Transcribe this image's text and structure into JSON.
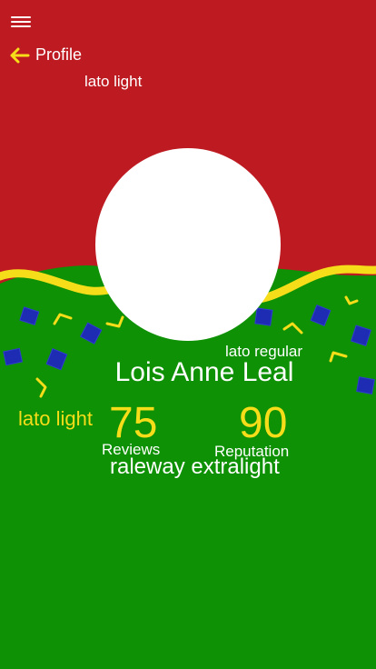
{
  "header": {
    "back_label": "Profile",
    "font_note": "lato light"
  },
  "profile": {
    "name": "Lois Anne Leal",
    "name_font_note": "lato regular",
    "stats_font_note": "lato light",
    "bottom_font_note": "raleway extralight"
  },
  "stats": {
    "reviews_value": "75",
    "reviews_label": "Reviews",
    "reputation_value": "90",
    "reputation_label": "Reputation"
  },
  "colors": {
    "red": "#bd1b21",
    "green": "#0e9104",
    "yellow": "#f6dd1a",
    "blue": "#1e2bb3"
  },
  "icons": {
    "menu": "hamburger-menu-icon",
    "back": "arrow-left-icon"
  }
}
